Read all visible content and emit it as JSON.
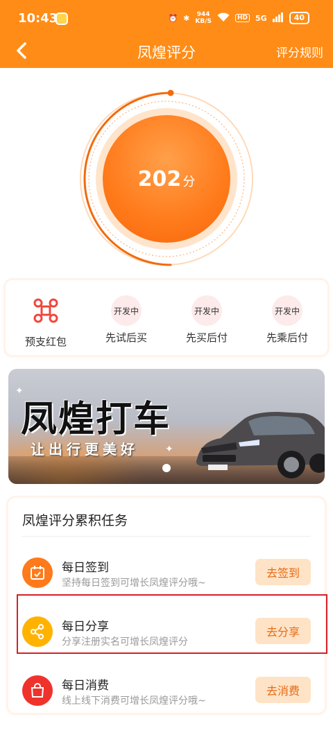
{
  "status_bar": {
    "time": "10:43",
    "speed_value": "944",
    "speed_unit": "KB/S",
    "hd": "HD",
    "network": "5G",
    "battery": "40"
  },
  "header": {
    "title": "凤煌评分",
    "rules_label": "评分规则"
  },
  "score": {
    "value": "202",
    "unit": "分"
  },
  "features": [
    {
      "label": "预支红包",
      "badge": ""
    },
    {
      "label": "先试后买",
      "badge": "开发中"
    },
    {
      "label": "先买后付",
      "badge": "开发中"
    },
    {
      "label": "先乘后付",
      "badge": "开发中"
    }
  ],
  "banner": {
    "headline": "凤煌打车",
    "tagline": "让出行更美好"
  },
  "tasks": {
    "title": "凤煌评分累积任务",
    "items": [
      {
        "name": "每日签到",
        "desc": "坚持每日签到可增长凤煌评分哦~",
        "button": "去签到",
        "icon": "calendar-icon",
        "color": "#ff7a1a"
      },
      {
        "name": "每日分享",
        "desc": "分享注册实名可增长凤煌评分",
        "button": "去分享",
        "icon": "share-icon",
        "color": "#ffb300"
      },
      {
        "name": "每日消费",
        "desc": "线上线下消费可增长凤煌评分哦~",
        "button": "去消费",
        "icon": "shopping-bag-icon",
        "color": "#f0322c"
      }
    ]
  },
  "colors": {
    "brand": "#ff8c17",
    "button_bg": "#ffe3c6",
    "button_text": "#e66a14",
    "highlight": "#d61f26"
  }
}
